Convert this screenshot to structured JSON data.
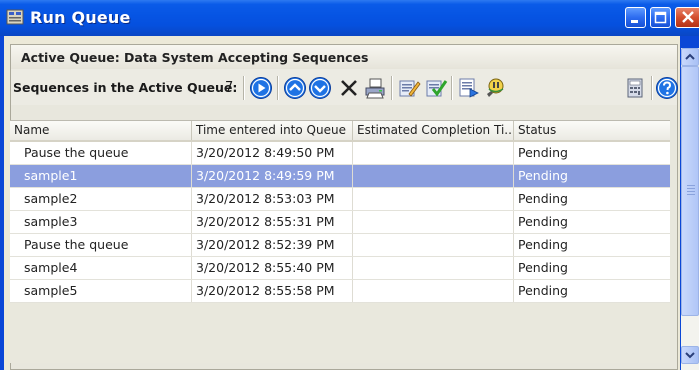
{
  "window": {
    "title": "Run Queue"
  },
  "panel": {
    "title": "Active Queue: Data System Accepting Sequences",
    "toolbar_label": "Sequences in the Active Queue:",
    "count": "7"
  },
  "toolbar_icons": [
    "play-icon",
    "move-up-icon",
    "move-down-icon",
    "delete-icon",
    "print-icon",
    "edit-icon",
    "checkmark-icon",
    "properties-icon",
    "find-icon",
    "calculator-icon",
    "help-icon"
  ],
  "table": {
    "columns": [
      "Name",
      "Time entered into Queue",
      "Estimated Completion Ti...",
      "Status"
    ],
    "rows": [
      {
        "name": "Pause the queue",
        "time": "3/20/2012 8:49:50 PM",
        "est": "",
        "status": "Pending"
      },
      {
        "name": "sample1",
        "time": "3/20/2012 8:49:59 PM",
        "est": "",
        "status": "Pending"
      },
      {
        "name": "sample2",
        "time": "3/20/2012 8:53:03 PM",
        "est": "",
        "status": "Pending"
      },
      {
        "name": "sample3",
        "time": "3/20/2012 8:55:31 PM",
        "est": "",
        "status": "Pending"
      },
      {
        "name": "Pause the queue",
        "time": "3/20/2012 8:52:39 PM",
        "est": "",
        "status": "Pending"
      },
      {
        "name": "sample4",
        "time": "3/20/2012 8:55:40 PM",
        "est": "",
        "status": "Pending"
      },
      {
        "name": "sample5",
        "time": "3/20/2012 8:55:58 PM",
        "est": "",
        "status": "Pending"
      }
    ],
    "selected_row_index": 1
  },
  "colors": {
    "titlebar": "#0654e3",
    "selection": "#8b9ede",
    "panel_bg": "#e8e7dd"
  }
}
